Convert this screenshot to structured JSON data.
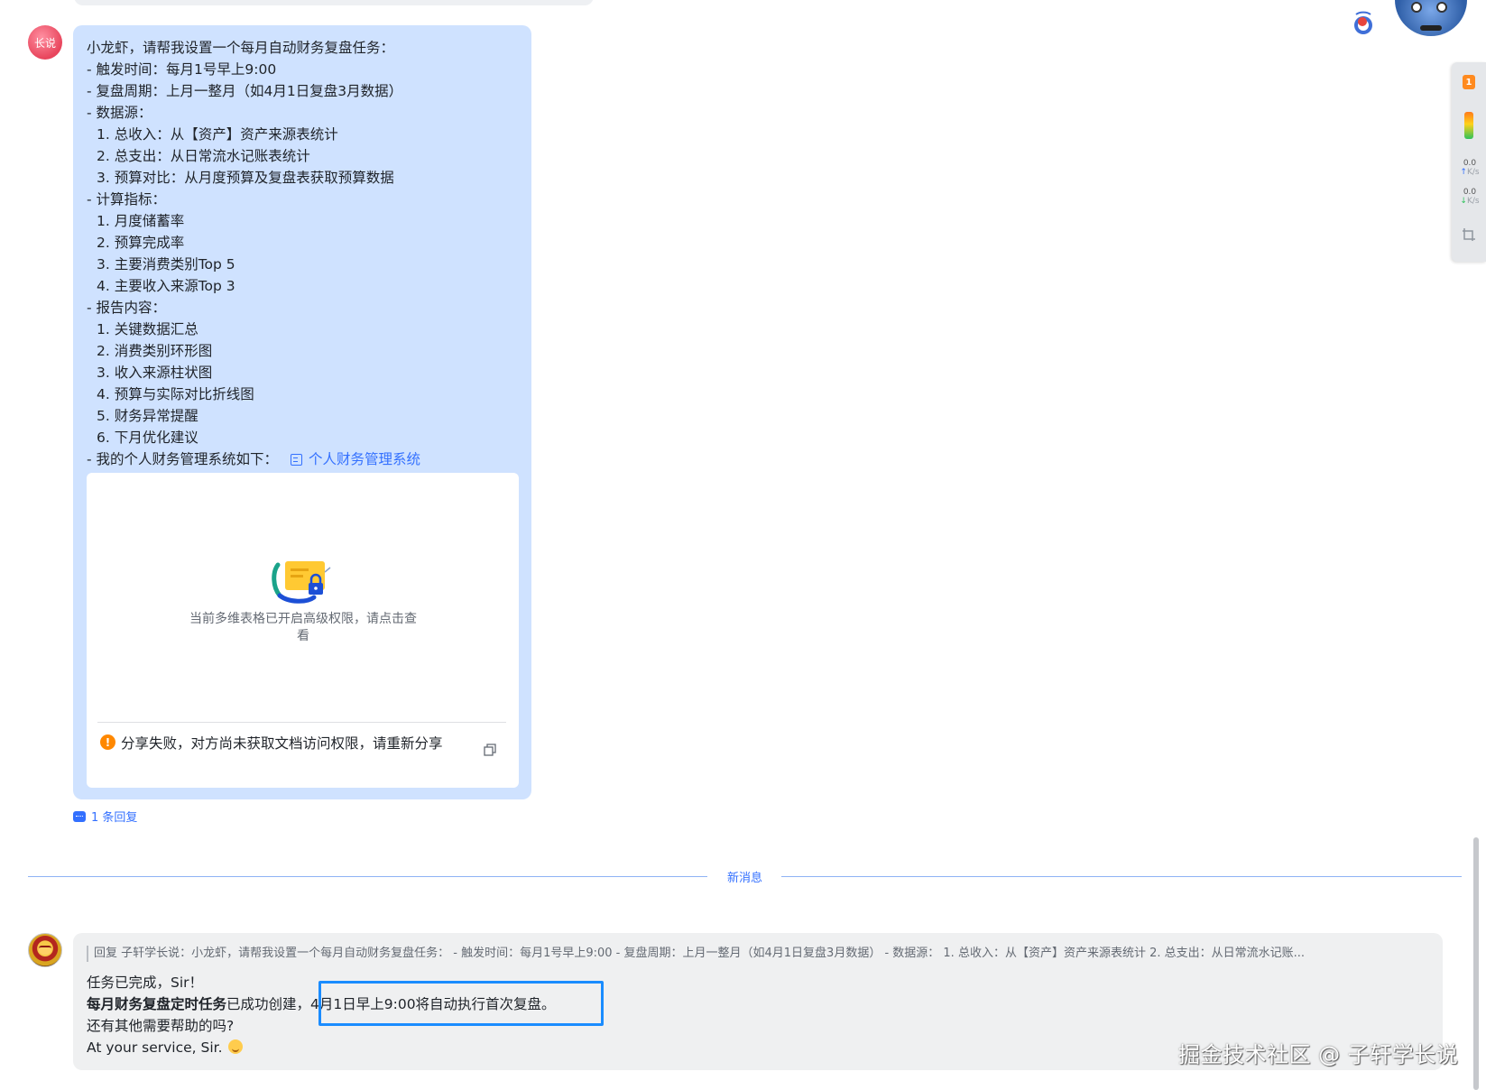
{
  "user_message": {
    "avatar_text": "长说",
    "lines": [
      "小龙虾，请帮我设置一个每月自动财务复盘任务：",
      "- 触发时间：每月1号早上9:00",
      "- 复盘周期：上月一整月（如4月1日复盘3月数据）",
      "- 数据源：",
      "1. 总收入：从【资产】资产来源表统计",
      "2. 总支出：从日常流水记账表统计",
      "3. 预算对比：从月度预算及复盘表获取预算数据",
      "- 计算指标：",
      "1. 月度储蓄率",
      "2. 预算完成率",
      "3. 主要消费类别Top 5",
      "4. 主要收入来源Top 3",
      "- 报告内容：",
      "1. 关键数据汇总",
      "2. 消费类别环形图",
      "3. 收入来源柱状图",
      "4. 预算与实际对比折线图",
      "5. 财务异常提醒",
      "6. 下月优化建议"
    ],
    "link_prefix": "- 我的个人财务管理系统如下：",
    "link_text": "个人财务管理系统",
    "card": {
      "notice": "当前多维表格已开启高级权限，请点击查看",
      "share_error": "分享失败，对方尚未获取文档访问权限，请重新分享"
    }
  },
  "reply_count": "1 条回复",
  "new_message_divider": "新消息",
  "bot_message": {
    "quote": "回复 子轩学长说：小龙虾，请帮我设置一个每月自动财务复盘任务： - 触发时间：每月1号早上9:00 - 复盘周期：上月一整月（如4月1日复盘3月数据） - 数据源： 1. 总收入：从【资产】资产来源表统计 2. 总支出：从日常流水记账...",
    "line1": "任务已完成，Sir！",
    "line2_bold": "每月财务复盘定时任务",
    "line2_rest": "已成功创建，",
    "line2_highlight": "4月1日早上9:00将自动执行首次复盘。",
    "line3": "还有其他需要帮助的吗?",
    "line4": "At your service, Sir."
  },
  "watermark": "掘金技术社区 @ 子轩学长说",
  "net_widget": {
    "badge": "1",
    "up_value": "0.0",
    "up_unit": "K/s",
    "down_value": "0.0",
    "down_unit": "K/s"
  },
  "colors": {
    "user_bubble": "#cfe2ff",
    "bot_bubble": "#eff0f1",
    "link": "#3370ff",
    "highlight_box": "#1a8cff",
    "warning": "#ff8800"
  }
}
